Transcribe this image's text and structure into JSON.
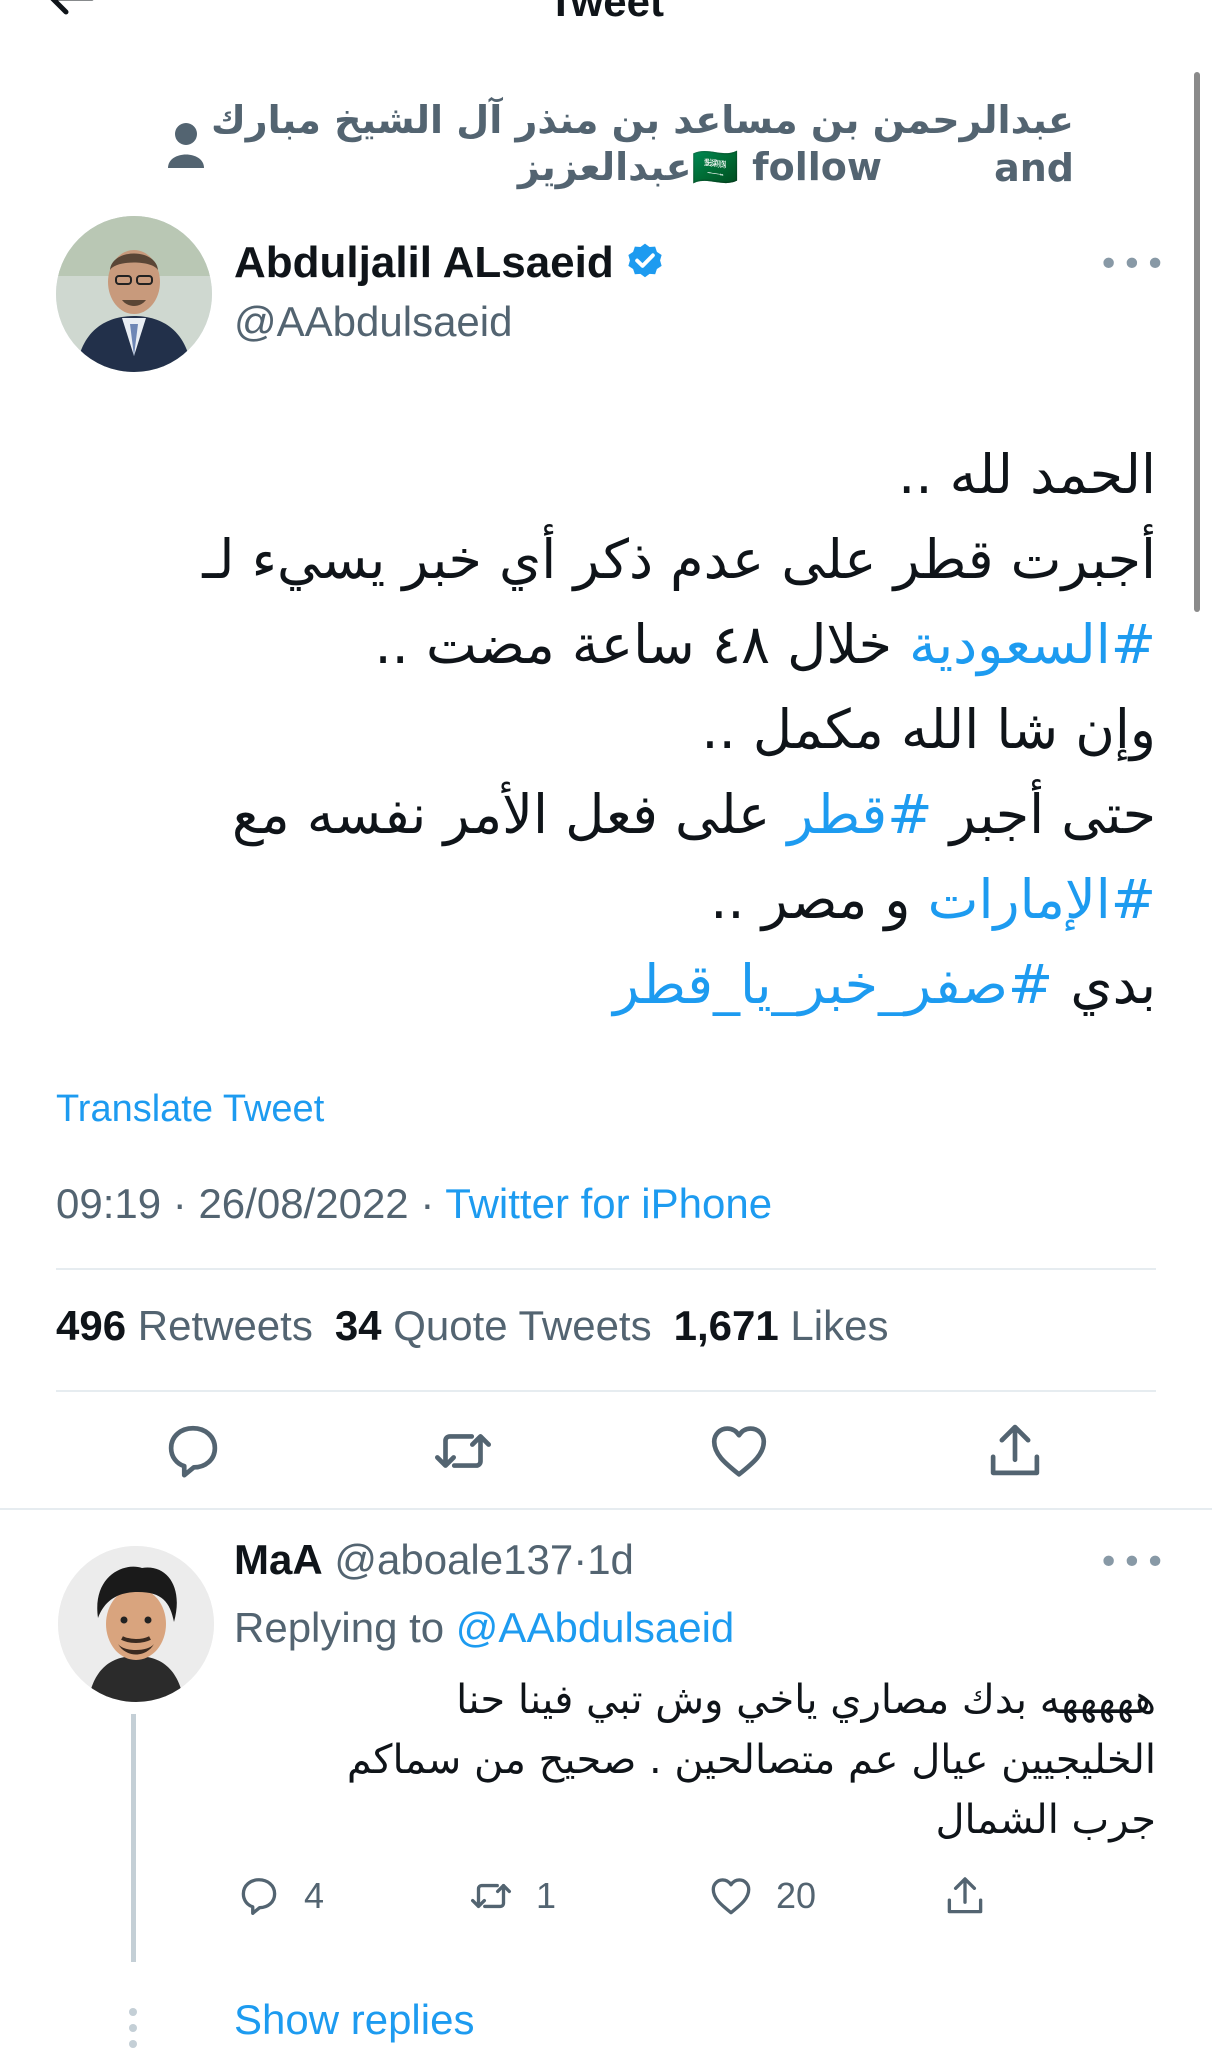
{
  "header": {
    "title": "Tweet"
  },
  "social_context": {
    "line1": "عبدالرحمن بن مساعد بن منذر آل الشيخ مبارك and",
    "line2": "عبدالعزيز🇸🇦 follow"
  },
  "author": {
    "name": "Abduljalil ALsaeid",
    "handle": "@AAbdulsaeid"
  },
  "tweet": {
    "lines": [
      [
        {
          "t": "الحمد لله ..",
          "h": false
        }
      ],
      [
        {
          "t": "أجبرت قطر على عدم ذكر أي خبر يسيء لـ",
          "h": false
        }
      ],
      [
        {
          "t": "#السعودية",
          "h": true
        },
        {
          "t": " خلال ٤٨ ساعة مضت ..",
          "h": false
        }
      ],
      [
        {
          "t": "وإن شا الله مكمل ..",
          "h": false
        }
      ],
      [
        {
          "t": "حتى أجبر ",
          "h": false
        },
        {
          "t": "#قطر",
          "h": true
        },
        {
          "t": " على فعل الأمر نفسه مع",
          "h": false
        }
      ],
      [
        {
          "t": "#الإمارات",
          "h": true
        },
        {
          "t": " و مصر ..",
          "h": false
        }
      ],
      [
        {
          "t": "بدي ",
          "h": false
        },
        {
          "t": "#صفر_خبر_يا_قطر",
          "h": true
        }
      ]
    ],
    "translate_label": "Translate Tweet",
    "time": "09:19",
    "date": "26/08/2022",
    "sep": "·",
    "source": "Twitter for iPhone"
  },
  "stats": {
    "retweets_count": "496",
    "retweets_label": "Retweets",
    "quotes_count": "34",
    "quotes_label": "Quote Tweets",
    "likes_count": "1,671",
    "likes_label": "Likes"
  },
  "icons": {
    "reply": "reply-icon",
    "retweet": "retweet-icon",
    "like": "heart-icon",
    "share": "share-icon",
    "more": "more-icon",
    "verified": "verified-badge-icon",
    "back": "back-arrow-icon"
  },
  "colors": {
    "accent": "#1d9bf0",
    "secondary_text": "#536471",
    "primary_text": "#0f1419",
    "divider": "#e6ecf0"
  },
  "reply": {
    "name": "MaA",
    "handle": "@aboale137",
    "dot": "·",
    "age": "1d",
    "replying_prefix": "Replying to",
    "replying_to": "@AAbdulsaeid",
    "lines": [
      "هههههه  بدك مصاري ياخي وش تبي فينا حنا",
      "الخليجيين عيال عم متصالحين . صحيح من سماكم",
      "جرب الشمال"
    ],
    "reply_count": "4",
    "retweet_count": "1",
    "like_count": "20"
  },
  "show_replies": "Show replies"
}
